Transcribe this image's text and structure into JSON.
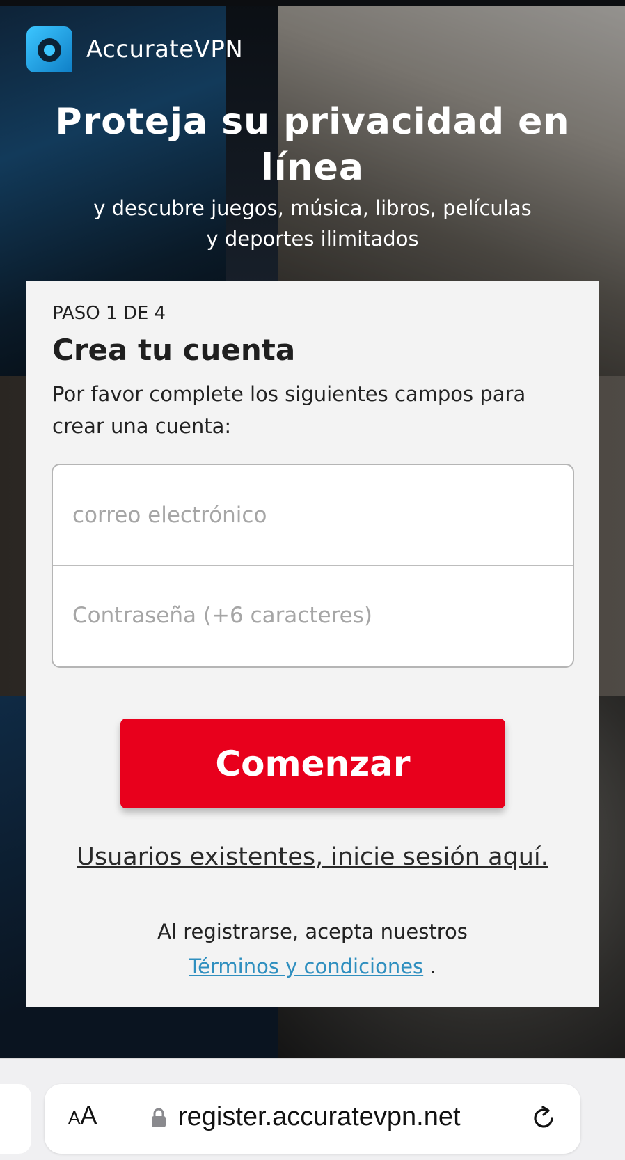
{
  "brand": {
    "name": "AccurateVPN",
    "logo_icon": "accuratevpn-logo-icon",
    "logo_color": "#1aa5e6"
  },
  "hero": {
    "title": "Proteja su privacidad en línea",
    "subtitle_line1": "y descubre juegos, música, libros, películas",
    "subtitle_line2": "y deportes ilimitados"
  },
  "form": {
    "step_label": "PASO 1 DE 4",
    "title": "Crea tu cuenta",
    "description": "Por favor complete los siguientes campos para crear una cuenta:",
    "email_placeholder": "correo electrónico",
    "email_value": "",
    "password_placeholder": "Contraseña (+6 caracteres)",
    "password_value": "",
    "submit_label": "Comenzar",
    "login_link": "Usuarios existentes, inicie sesión aquí.",
    "terms_prefix": "Al registrarse, acepta nuestros",
    "terms_link": "Términos y condiciones",
    "terms_suffix": "."
  },
  "colors": {
    "accent": "#e8001c",
    "link": "#2f8fbf",
    "card_bg": "#f3f3f3"
  },
  "browser": {
    "text_size_small": "A",
    "text_size_big": "A",
    "lock_icon": "lock-icon",
    "url": "register.accuratevpn.net",
    "reload_icon": "reload-icon"
  }
}
